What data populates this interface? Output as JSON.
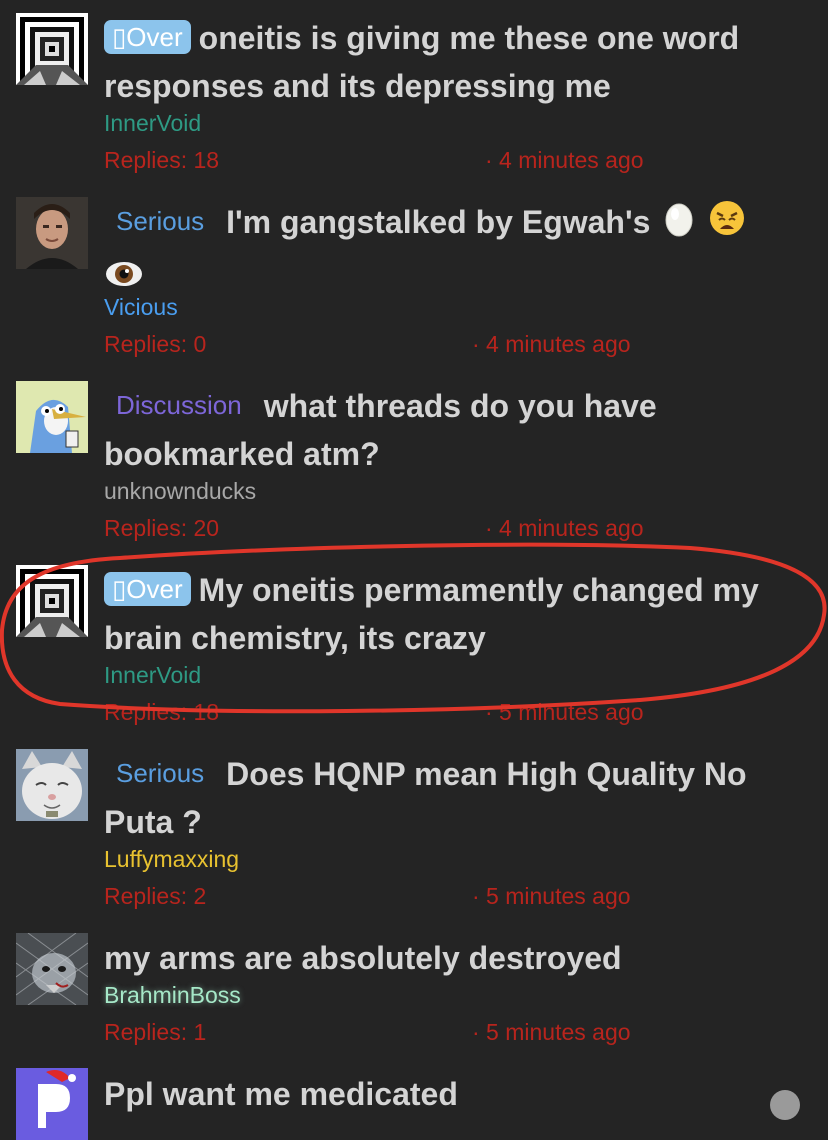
{
  "threads": [
    {
      "badge": "▯Over",
      "title": "oneitis is giving me these one word responses and its depressing me",
      "author": "InnerVoid",
      "replies": "Replies: 18",
      "time": "· 4 minutes ago"
    },
    {
      "badge": "Serious",
      "title": "I'm gangstalked by Egwah's",
      "emojis": [
        "egg-emoji",
        "weary-face-emoji",
        "eye-emoji"
      ],
      "author": "Vicious",
      "replies": "Replies: 0",
      "time": "· 4 minutes ago"
    },
    {
      "badge": "Discussion",
      "title": "what threads do you have bookmarked atm?",
      "author": "unknownducks",
      "replies": "Replies: 20",
      "time": "· 4 minutes ago"
    },
    {
      "badge": "▯Over",
      "title": "My oneitis permamently changed my brain chemistry, its crazy",
      "author": "InnerVoid",
      "replies": "Replies: 18",
      "time": "· 5 minutes ago",
      "highlighted": true
    },
    {
      "badge": "Serious",
      "title": "Does HQNP mean High Quality No Puta ?",
      "author": "Luffymaxxing",
      "replies": "Replies: 2",
      "time": "· 5 minutes ago"
    },
    {
      "title": "my arms are absolutely destroyed",
      "author": "BrahminBoss",
      "replies": "Replies: 1",
      "time": "· 5 minutes ago"
    },
    {
      "title": "Ppl want me medicated"
    }
  ],
  "colors": {
    "background": "#242424",
    "title": "#d4d4d4",
    "meta_red": "#b8241d",
    "badge_over_bg": "#8cc4ec",
    "serious": "#5a9ee0",
    "discussion": "#7d66d8",
    "author_innervoid": "#2e9a84",
    "author_vicious": "#4a9ef0",
    "author_unknownducks": "#a8a8a8",
    "author_luffymaxxing": "#e8c230",
    "author_brahminboss": "#a6e8c8",
    "annotation_ring": "#e0362a"
  }
}
